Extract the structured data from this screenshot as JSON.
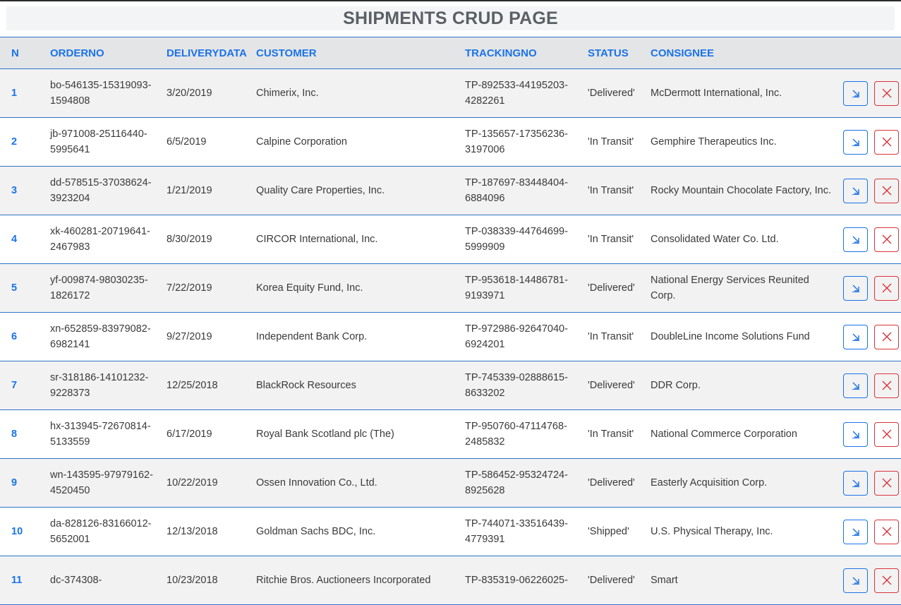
{
  "page": {
    "title": "SHIPMENTS CRUD PAGE"
  },
  "table": {
    "headers": [
      "N",
      "ORDERNO",
      "DELIVERYDATA",
      "CUSTOMER",
      "TRACKINGNO",
      "STATUS",
      "CONSIGNEE"
    ],
    "rows": [
      {
        "n": "1",
        "orderno": "bo-546135-15319093-1594808",
        "delivery": "3/20/2019",
        "customer": "Chimerix, Inc.",
        "tracking": "TP-892533-44195203-4282261",
        "status": "'Delivered'",
        "consignee": "McDermott International, Inc."
      },
      {
        "n": "2",
        "orderno": "jb-971008-25116440-5995641",
        "delivery": "6/5/2019",
        "customer": "Calpine Corporation",
        "tracking": "TP-135657-17356236-3197006",
        "status": "'In Transit'",
        "consignee": "Gemphire Therapeutics Inc."
      },
      {
        "n": "3",
        "orderno": "dd-578515-37038624-3923204",
        "delivery": "1/21/2019",
        "customer": "Quality Care Properties, Inc.",
        "tracking": "TP-187697-83448404-6884096",
        "status": "'In Transit'",
        "consignee": "Rocky Mountain Chocolate Factory, Inc."
      },
      {
        "n": "4",
        "orderno": "xk-460281-20719641-2467983",
        "delivery": "8/30/2019",
        "customer": "CIRCOR International, Inc.",
        "tracking": "TP-038339-44764699-5999909",
        "status": "'In Transit'",
        "consignee": "Consolidated Water Co. Ltd."
      },
      {
        "n": "5",
        "orderno": "yf-009874-98030235-1826172",
        "delivery": "7/22/2019",
        "customer": "Korea Equity Fund, Inc.",
        "tracking": "TP-953618-14486781-9193971",
        "status": "'Delivered'",
        "consignee": "National Energy Services Reunited Corp."
      },
      {
        "n": "6",
        "orderno": "xn-652859-83979082-6982141",
        "delivery": "9/27/2019",
        "customer": "Independent Bank Corp.",
        "tracking": "TP-972986-92647040-6924201",
        "status": "'In Transit'",
        "consignee": "DoubleLine Income Solutions Fund"
      },
      {
        "n": "7",
        "orderno": "sr-318186-14101232-9228373",
        "delivery": "12/25/2018",
        "customer": "BlackRock Resources",
        "tracking": "TP-745339-02888615-8633202",
        "status": "'Delivered'",
        "consignee": "DDR Corp."
      },
      {
        "n": "8",
        "orderno": "hx-313945-72670814-5133559",
        "delivery": "6/17/2019",
        "customer": "Royal Bank Scotland plc (The)",
        "tracking": "TP-950760-47114768-2485832",
        "status": "'In Transit'",
        "consignee": "National Commerce Corporation"
      },
      {
        "n": "9",
        "orderno": "wn-143595-97979162-4520450",
        "delivery": "10/22/2019",
        "customer": "Ossen Innovation Co., Ltd.",
        "tracking": "TP-586452-95324724-8925628",
        "status": "'Delivered'",
        "consignee": "Easterly Acquisition Corp."
      },
      {
        "n": "10",
        "orderno": "da-828126-83166012-5652001",
        "delivery": "12/13/2018",
        "customer": "Goldman Sachs BDC, Inc.",
        "tracking": "TP-744071-33516439-4779391",
        "status": "'Shipped'",
        "consignee": "U.S. Physical Therapy, Inc."
      },
      {
        "n": "11",
        "orderno": "dc-374308-",
        "delivery": "10/23/2018",
        "customer": "Ritchie Bros. Auctioneers Incorporated",
        "tracking": "TP-835319-06226025-",
        "status": "'Delivered'",
        "consignee": "Smart"
      }
    ]
  },
  "icons": {
    "edit": "arrow-down-right-icon",
    "delete": "close-x-icon"
  },
  "colors": {
    "accent": "#1a73e8",
    "danger": "#d9343c",
    "header_bg": "#e4e5e7",
    "row_alt_bg": "#f2f2f2"
  }
}
